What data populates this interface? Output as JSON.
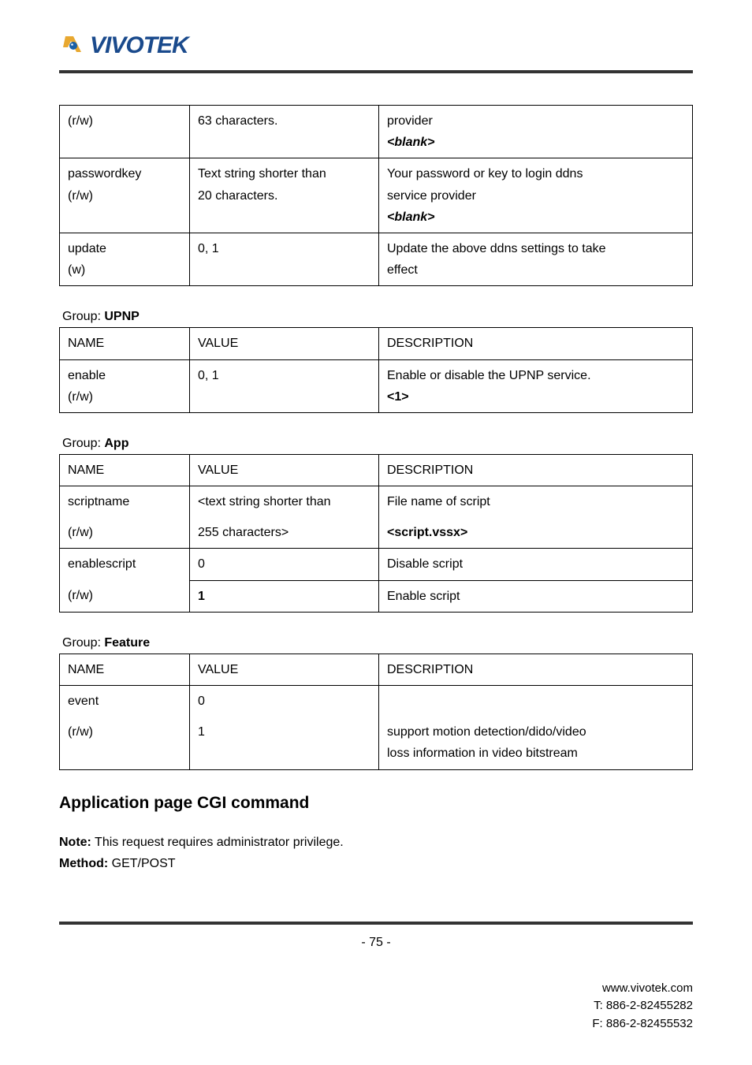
{
  "logo_text": "VIVOTEK",
  "table_top": {
    "rows": [
      {
        "c1": "(r/w)",
        "c2": "63 characters.",
        "c3a": "provider",
        "c3b": "<blank>"
      },
      {
        "c1a": "passwordkey",
        "c1b": "(r/w)",
        "c2a": "Text string shorter than",
        "c2b": "20 characters.",
        "c3a": "Your password or key to login ddns",
        "c3b": "service provider",
        "c3c": "<blank>"
      },
      {
        "c1a": "update",
        "c1b": "(w)",
        "c2": "0, 1",
        "c3a": "Update the above ddns settings to take",
        "c3b": "effect"
      }
    ]
  },
  "groups": [
    {
      "label_prefix": "Group: ",
      "label": "UPNP",
      "headers": [
        "NAME",
        "VALUE",
        "DESCRIPTION"
      ],
      "rows": [
        {
          "c1a": "enable",
          "c1b": "(r/w)",
          "c2": "0, 1",
          "c3a": "Enable or disable the UPNP service.",
          "c3b": "<1>"
        }
      ]
    },
    {
      "label_prefix": "Group: ",
      "label": "App",
      "headers": [
        "NAME",
        "VALUE",
        "DESCRIPTION"
      ],
      "rows": [
        {
          "c1a": "scriptname",
          "c1b": "(r/w)",
          "c2a": "<text string shorter than",
          "c2b": "255 characters>",
          "c3a": "File name of script",
          "c3b": "<script.vssx>"
        },
        {
          "c1a": "enablescript",
          "c1b": "(r/w)",
          "c2a": "0",
          "c2b": "1",
          "c3a": "Disable script",
          "c3b": "Enable script"
        }
      ]
    },
    {
      "label_prefix": "Group: ",
      "label": "Feature",
      "headers": [
        "NAME",
        "VALUE",
        "DESCRIPTION"
      ],
      "rows": [
        {
          "c1a": "event",
          "c1b": "(r/w)",
          "c2a": "0",
          "c2b": "1",
          "c3a": "",
          "c3b": "support motion detection/dido/video",
          "c3c": "loss information in video bitstream"
        }
      ]
    }
  ],
  "section_heading": "Application page CGI command",
  "note_label": "Note:",
  "note_text": " This request requires administrator privilege.",
  "method_label": "Method:",
  "method_text": " GET/POST",
  "page_number": "- 75 -",
  "footer": {
    "url": "www.vivotek.com",
    "tel": "T: 886-2-82455282",
    "fax": "F: 886-2-82455532"
  }
}
